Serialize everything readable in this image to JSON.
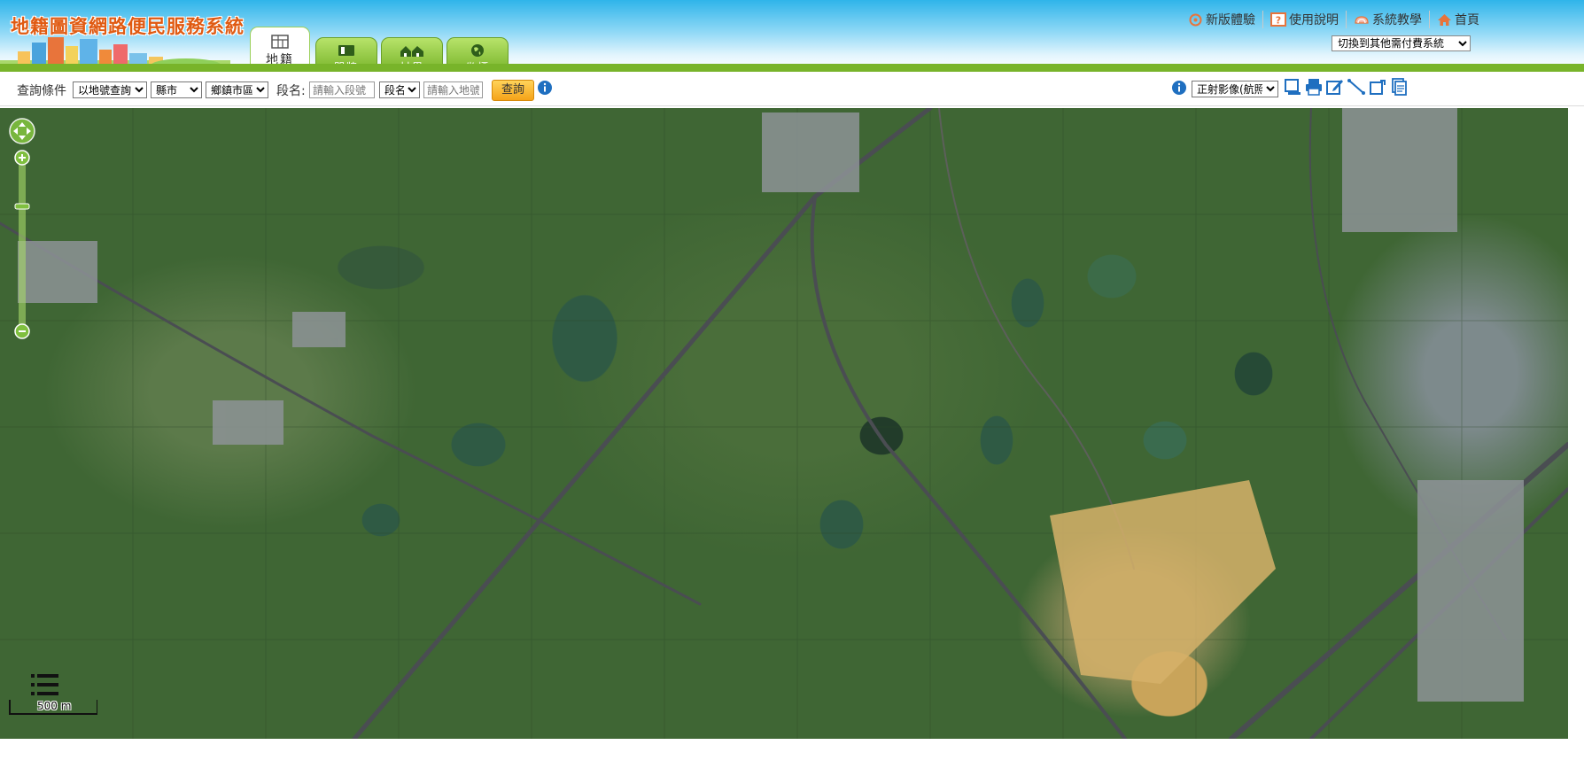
{
  "header": {
    "title": "地籍圖資網路便民服務系統",
    "tabs": [
      {
        "label": "地籍",
        "icon": "map-icon",
        "active": true
      },
      {
        "label": "門牌",
        "icon": "door-plate-icon",
        "active": false
      },
      {
        "label": "村里",
        "icon": "village-icon",
        "active": false
      },
      {
        "label": "坐標",
        "icon": "globe-icon",
        "active": false
      }
    ],
    "links": [
      {
        "label": "新版體驗",
        "icon": "new-version-icon"
      },
      {
        "label": "使用說明",
        "icon": "help-icon"
      },
      {
        "label": "系統教學",
        "icon": "tutorial-icon"
      },
      {
        "label": "首頁",
        "icon": "home-icon"
      }
    ],
    "system_switch": {
      "selected": "切換到其他需付費系統"
    }
  },
  "toolbar": {
    "query_condition_label": "查詢條件",
    "query_type": {
      "selected": "以地號查詢"
    },
    "county": {
      "selected": "縣市"
    },
    "township": {
      "selected": "鄉鎮市區"
    },
    "section_label": "段名:",
    "section_input": {
      "placeholder": "請輸入段號",
      "value": ""
    },
    "section_name": {
      "selected": "段名"
    },
    "land_number_input": {
      "placeholder": "請輸入地號",
      "value": ""
    },
    "query_button": "查詢",
    "basemap": {
      "selected": "正射影像(航照)"
    },
    "tools": [
      "layer-icon",
      "print-icon",
      "edit-icon",
      "measure-line-icon",
      "measure-area-icon",
      "copy-icon"
    ]
  },
  "map": {
    "scale_label": "500 m",
    "colors": {
      "field": "#3f6634",
      "pond": "#2f5a44",
      "road": "#4a4d52",
      "urban": "#7d8a8c"
    }
  }
}
